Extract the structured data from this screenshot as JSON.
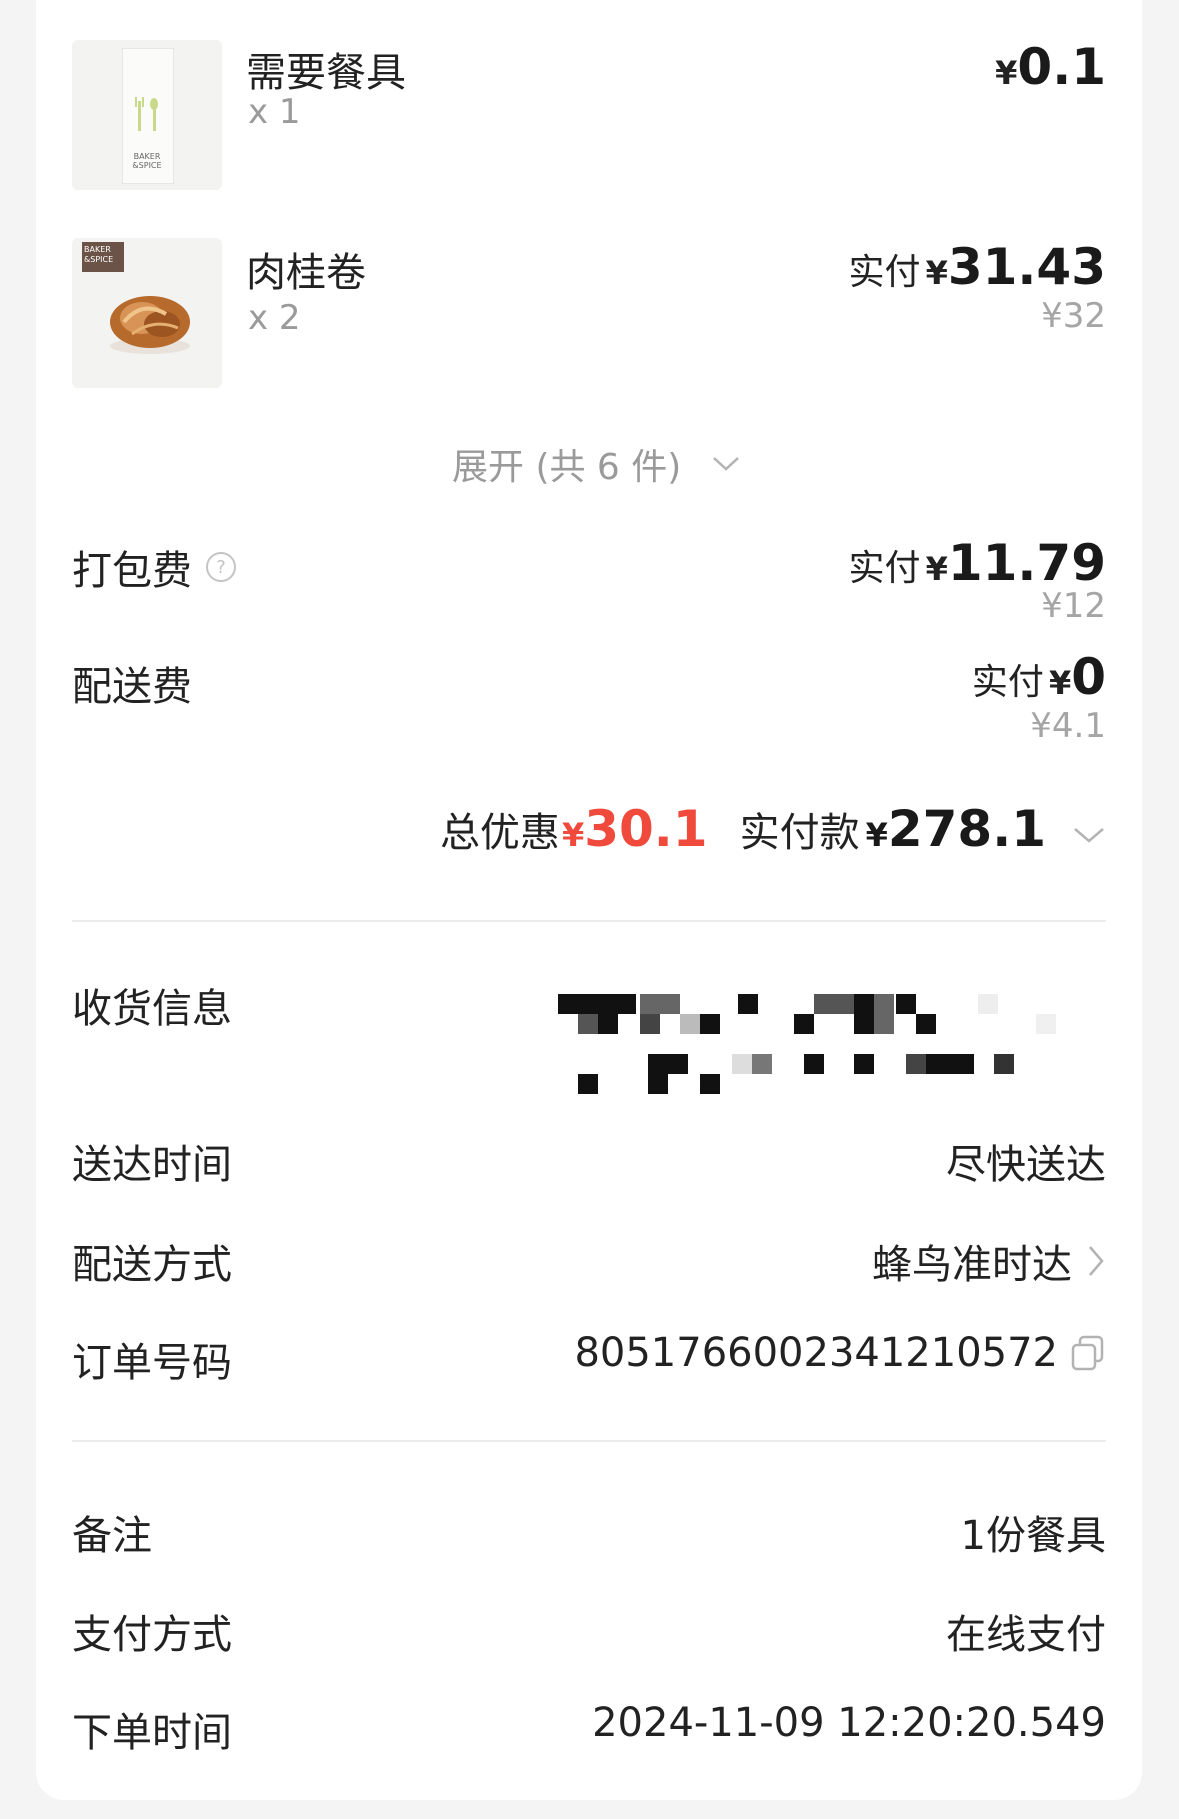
{
  "items": [
    {
      "name": "需要餐具",
      "qty": "x 1",
      "price_symbol": "¥",
      "price": "0.1",
      "thumb_text": "BAKER\n&SPICE"
    },
    {
      "name": "肉桂卷",
      "qty": "x 2",
      "paid_label": "实付",
      "price_symbol": "¥",
      "price": "31.43",
      "original": "¥32",
      "thumb_text": "BAKER\n&SPICE"
    }
  ],
  "expand": {
    "label": "展开 (共 6 件)"
  },
  "fees": [
    {
      "label": "打包费",
      "paid_label": "实付",
      "symbol": "¥",
      "price": "11.79",
      "original": "¥12"
    },
    {
      "label": "配送费",
      "paid_label": "实付",
      "symbol": "¥",
      "price": "0",
      "original": "¥4.1"
    }
  ],
  "summary": {
    "discount_label": "总优惠",
    "discount_symbol": "¥",
    "discount_value": "30.1",
    "paid_label": "实付款",
    "paid_symbol": "¥",
    "paid_value": "278.1"
  },
  "info": {
    "address_label": "收货信息",
    "delivery_time_label": "送达时间",
    "delivery_time_value": "尽快送达",
    "delivery_method_label": "配送方式",
    "delivery_method_value": "蜂鸟准时达",
    "order_no_label": "订单号码",
    "order_no_value": "8051766002341210572"
  },
  "extra": {
    "remark_label": "备注",
    "remark_value": "1份餐具",
    "payment_label": "支付方式",
    "payment_value": "在线支付",
    "order_time_label": "下单时间",
    "order_time_value": "2024-11-09 12:20:20.549"
  },
  "colors": {
    "accent_red": "#ef4a3c",
    "text": "#222222",
    "muted": "#9a9a9a",
    "divider": "#ececec"
  }
}
